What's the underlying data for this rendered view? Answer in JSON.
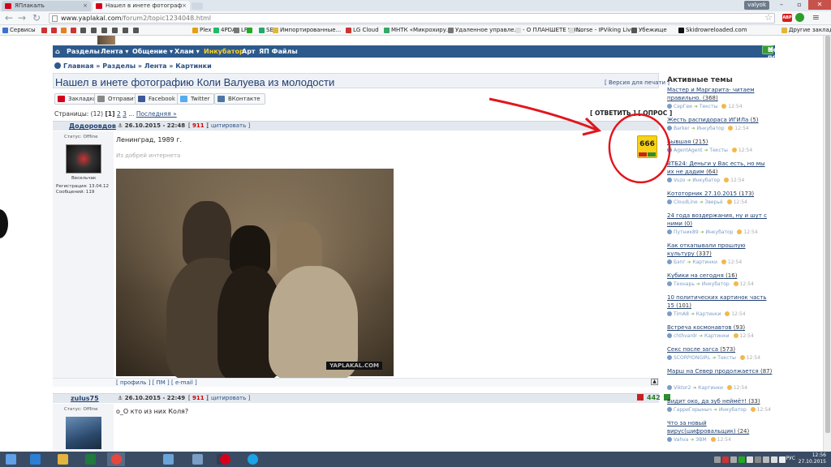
{
  "browser": {
    "tabs": [
      {
        "label": "ЯПлакалъ",
        "active": false
      },
      {
        "label": "Нашел в инете фотограф",
        "active": true
      }
    ],
    "user_badge": "valyok",
    "url_domain": "www.yaplakal.com",
    "url_path": "/forum2/topic1234048.html",
    "bookmarks": [
      {
        "label": "Сервисы",
        "color": "#3b6fd4"
      },
      {
        "label": "",
        "color": "#c33"
      },
      {
        "label": "",
        "color": "#c33"
      },
      {
        "label": "",
        "color": "#e67e22"
      },
      {
        "label": "",
        "color": "#c33"
      },
      {
        "label": "",
        "color": "#555"
      },
      {
        "label": "",
        "color": "#555"
      },
      {
        "label": "",
        "color": "#555"
      },
      {
        "label": "",
        "color": "#555"
      },
      {
        "label": "",
        "color": "#555"
      },
      {
        "label": "",
        "color": "#555"
      },
      {
        "label": "Plex",
        "color": "#e5a00d"
      },
      {
        "label": "4PDA",
        "color": "#2b6"
      },
      {
        "label": "LF",
        "color": "#777"
      },
      {
        "label": "",
        "color": "#2a2"
      },
      {
        "label": "SEB",
        "color": "#2a6"
      },
      {
        "label": "Импортированные...",
        "color": "#e2b53d"
      },
      {
        "label": "LG Cloud",
        "color": "#c33"
      },
      {
        "label": "МНТК «Микрохиру...",
        "color": "#3a6"
      },
      {
        "label": "Удаленное управле...",
        "color": "#777"
      },
      {
        "label": "- О ПЛАНШЕТЕ SHI...",
        "color": "#ddd"
      },
      {
        "label": "Norse - IPViking Live",
        "color": "#ddd"
      },
      {
        "label": "Убежище",
        "color": "#555"
      },
      {
        "label": "Skidrowreloaded.com",
        "color": "#111"
      },
      {
        "label": "Другие закладки",
        "color": "#e2b53d"
      }
    ]
  },
  "navbar": {
    "items": [
      "Разделы",
      "Лента ▾",
      "Общение ▾",
      "Хлам ▾",
      "Инкубатор",
      "Арт",
      "ЯП Файлы"
    ],
    "new_post": "Новый пост"
  },
  "breadcrumb": "Главная » Разделы » Лента » Картинки",
  "topic": {
    "title": "Нашел в инете фотографию Коли Валуева из молодости",
    "print_version": "[ Версия для печати ]"
  },
  "share": [
    {
      "label": "Закладки",
      "color": "#d6001c"
    },
    {
      "label": "Отправить",
      "color": "#888"
    },
    {
      "label": "Facebook",
      "color": "#3b5998"
    },
    {
      "label": "Twitter",
      "color": "#55acee"
    },
    {
      "label": "ВКонтакте",
      "color": "#4c75a3"
    }
  ],
  "pager": {
    "label": "Страницы: (12)",
    "current": "[1]",
    "pages": [
      "2",
      "3"
    ],
    "ellipsis": "...",
    "last": "Последняя »"
  },
  "reply_poll": "[ ОТВЕТИТЬ ] [ ОПРОС ]",
  "posts": [
    {
      "user": "Додоровдов",
      "date": "26.10.2015 - 22:48",
      "rep": "911",
      "quote": "[ цитировать ]",
      "status": "Статус: Offline",
      "rank": "Весельчак",
      "reg": "Регистрация: 13.04.12",
      "msgs": "Сообщений: 119",
      "text": "Ленинград, 1989 г.",
      "subtext": "Из добрей интернета",
      "watermark": "YAPLAKAL.COM",
      "rating": "666",
      "footer": "[ профиль ] [ ПМ ] [ e-mail ]"
    },
    {
      "user": "zulus75",
      "date": "26.10.2015 - 22:49",
      "rep": "911",
      "quote": "[ цитировать ]",
      "status": "Статус: Offline",
      "text": "о_О кто из них Коля?",
      "rating": "442"
    }
  ],
  "sidebar": {
    "title": "Активные темы",
    "topics": [
      {
        "title": "Мастер и Маргарита- читаем правильно.",
        "count": "(368)",
        "user": "СерГеи",
        "section": "Тексты",
        "time": "12:54"
      },
      {
        "title": "Жесть распидораса ИГИЛа",
        "count": "(5)",
        "user": "Barker",
        "section": "Инкубатор",
        "time": "12:54"
      },
      {
        "title": "Бывшая",
        "count": "(215)",
        "user": "AgentAgent",
        "section": "Тексты",
        "time": "12:54"
      },
      {
        "title": "ВТБ24: Деньги у Вас есть, но мы их не дадим",
        "count": "(64)",
        "user": "Vuzo",
        "section": "Инкубатор",
        "time": "12:54"
      },
      {
        "title": "Кототорник 27.10.2015",
        "count": "(173)",
        "user": "CloudLine",
        "section": "Зверьё",
        "time": "12:54"
      },
      {
        "title": "24 года воздержания, ну и шут с ними",
        "count": "(0)",
        "user": "Путник89",
        "section": "Инкубатор",
        "time": "12:54"
      },
      {
        "title": "Как откапывали прошлую культуру",
        "count": "(337)",
        "user": "Бэпг",
        "section": "Картинки",
        "time": "12:54"
      },
      {
        "title": "Кубики на сегодня",
        "count": "(16)",
        "user": "Технарь",
        "section": "Инкубатор",
        "time": "12:54"
      },
      {
        "title": "10 политических картинок часть 15",
        "count": "(101)",
        "user": "TimA8",
        "section": "Картинки",
        "time": "12:54"
      },
      {
        "title": "Встреча космонавтов",
        "count": "(93)",
        "user": "chthvardr",
        "section": "Картинки",
        "time": "12:54"
      },
      {
        "title": "Секс после загса",
        "count": "(573)",
        "user": "SCORPIONGIRL",
        "section": "Тексты",
        "time": "12:54"
      },
      {
        "title": "Марш на Север продолжается",
        "count": "(87)",
        "user": "Viktor2",
        "section": "Картинки",
        "time": "12:54"
      },
      {
        "title": "Видит око, да зуб неймёт!",
        "count": "(33)",
        "user": "ГарриГорыныч",
        "section": "Инкубатор",
        "time": "12:54"
      },
      {
        "title": "Что за новый вирус(шифровальщик)",
        "count": "(24)",
        "user": "Vahva",
        "section": "ЭВМ",
        "time": "12:54"
      }
    ]
  },
  "taskbar": {
    "apps": [
      {
        "name": "start",
        "color": "#5fa0e8"
      },
      {
        "name": "ie",
        "color": "#2a7fd4"
      },
      {
        "name": "explorer",
        "color": "#e3b440"
      },
      {
        "name": "excel",
        "color": "#1f7a3c"
      },
      {
        "name": "chrome",
        "color": "#e8463c"
      },
      {
        "name": "paint",
        "color": "#6aa4d8"
      },
      {
        "name": "remote",
        "color": "#7a9ec5"
      },
      {
        "name": "monitor",
        "color": "#2f3f55"
      },
      {
        "name": "opera",
        "color": "#d6001c"
      },
      {
        "name": "skype",
        "color": "#1aa3e6"
      }
    ],
    "lang": "РУС",
    "time": "12:56",
    "date": "27.10.2015"
  }
}
